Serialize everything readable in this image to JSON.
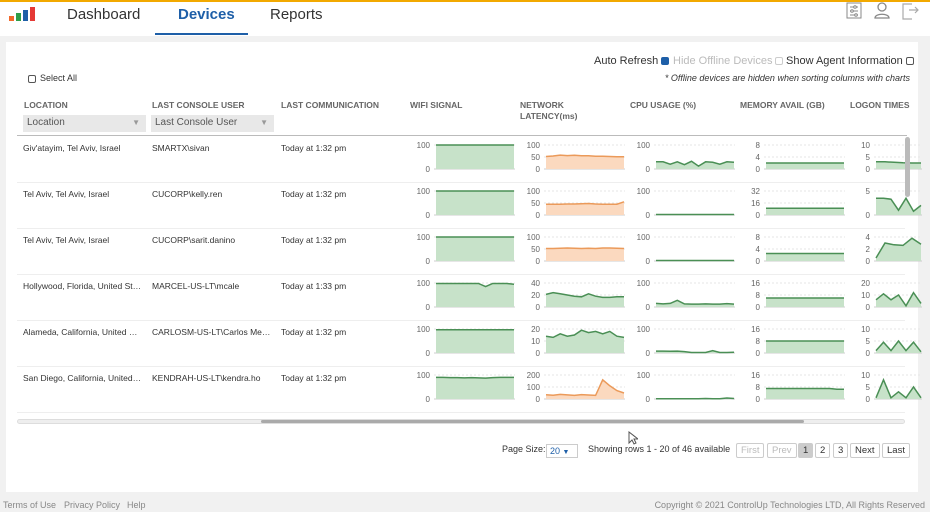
{
  "nav": {
    "tabs": [
      {
        "label": "Dashboard"
      },
      {
        "label": "Devices",
        "active": true
      },
      {
        "label": "Reports"
      }
    ],
    "icons": [
      "settings-sliders-icon",
      "user-icon",
      "logout-icon"
    ]
  },
  "colors": {
    "accent": "#1e5fa8",
    "top_bar": "#f2a900",
    "green_line": "#4a8f55",
    "green_fill": "#c7e2c9",
    "orange_line": "#eb9a5a",
    "orange_fill": "#fbd9bf"
  },
  "options": {
    "auto_refresh": "Auto Refresh",
    "auto_refresh_checked": true,
    "hide_offline": "Hide Offline Devices",
    "hide_offline_checked": false,
    "show_agent": "Show Agent Information",
    "show_agent_checked": false,
    "note": "* Offline devices are hidden when sorting columns with charts",
    "select_all": "Select All"
  },
  "columns": {
    "location": "LOCATION",
    "user": "LAST CONSOLE USER",
    "comm": "LAST COMMUNICATION",
    "wifi": "WIFI SIGNAL",
    "latency": "NETWORK LATENCY(ms)",
    "cpu": "CPU USAGE (%)",
    "mem": "MEMORY AVAIL (GB)",
    "logon": "LOGON TIMES (",
    "location_filter": "Location",
    "user_filter": "Last Console User"
  },
  "rows": [
    {
      "location": "Giv'atayim, Tel Aviv, Israel",
      "user": "SMARTX\\sivan",
      "comm": "Today at 1:32 pm",
      "charts": [
        {
          "ticks": [
            100,
            0
          ],
          "max": 100,
          "color": "green",
          "values": [
            100,
            100,
            100,
            100,
            100,
            100,
            100,
            100,
            100,
            100,
            100,
            100
          ]
        },
        {
          "ticks": [
            100,
            50,
            0
          ],
          "max": 100,
          "color": "orange",
          "values": [
            52,
            54,
            58,
            56,
            57,
            55,
            55,
            53,
            53,
            52,
            51,
            51
          ]
        },
        {
          "ticks": [
            100,
            0
          ],
          "max": 100,
          "color": "green",
          "values": [
            30,
            30,
            20,
            30,
            18,
            32,
            12,
            30,
            28,
            20,
            30,
            28
          ]
        },
        {
          "ticks": [
            8,
            4,
            0
          ],
          "max": 8,
          "color": "green",
          "values": [
            2,
            2,
            2,
            2,
            2,
            2,
            2,
            2,
            2,
            2,
            2,
            2
          ]
        },
        {
          "ticks": [
            10,
            5,
            0
          ],
          "max": 10,
          "color": "green",
          "values": [
            3,
            3,
            2.8,
            2.6,
            2.5,
            2.5
          ]
        }
      ]
    },
    {
      "location": "Tel Aviv, Tel Aviv, Israel",
      "user": "CUCORP\\kelly.ren",
      "comm": "Today at 1:32 pm",
      "charts": [
        {
          "ticks": [
            100,
            0
          ],
          "max": 100,
          "color": "green",
          "values": [
            100,
            100,
            100,
            100,
            100,
            100,
            100,
            100,
            100,
            100,
            100,
            100
          ]
        },
        {
          "ticks": [
            100,
            50,
            0
          ],
          "max": 100,
          "color": "orange",
          "values": [
            45,
            45,
            45,
            46,
            46,
            47,
            48,
            46,
            45,
            45,
            45,
            55
          ]
        },
        {
          "ticks": [
            100,
            0
          ],
          "max": 100,
          "color": "green",
          "values": [
            2,
            2,
            2,
            2,
            2,
            2,
            2,
            2,
            2,
            2,
            2,
            2
          ]
        },
        {
          "ticks": [
            32,
            16,
            0
          ],
          "max": 32,
          "color": "green",
          "values": [
            9,
            9,
            9,
            9,
            9,
            9,
            9,
            9,
            9,
            9,
            9,
            9
          ]
        },
        {
          "ticks": [
            5,
            0
          ],
          "max": 5,
          "color": "green",
          "values": [
            3.5,
            3.5,
            3.3,
            1,
            3.5,
            0.8,
            2
          ]
        }
      ]
    },
    {
      "location": "Tel Aviv, Tel Aviv, Israel",
      "user": "CUCORP\\sarit.danino",
      "comm": "Today at 1:32 pm",
      "charts": [
        {
          "ticks": [
            100,
            0
          ],
          "max": 100,
          "color": "green",
          "values": [
            100,
            100,
            100,
            100,
            100,
            100,
            100,
            100,
            100,
            100,
            100,
            100
          ]
        },
        {
          "ticks": [
            100,
            50,
            0
          ],
          "max": 100,
          "color": "orange",
          "values": [
            52,
            52,
            53,
            54,
            53,
            52,
            53,
            52,
            54,
            54,
            53,
            52
          ]
        },
        {
          "ticks": [
            100,
            0
          ],
          "max": 100,
          "color": "green",
          "values": [
            2,
            2,
            2,
            2,
            2,
            2,
            2,
            2,
            2,
            2,
            2,
            2
          ]
        },
        {
          "ticks": [
            8,
            4,
            0
          ],
          "max": 8,
          "color": "green",
          "values": [
            2.5,
            2.5,
            2.5,
            2.5,
            2.5,
            2.5,
            2.5,
            2.5,
            2.5,
            2.5,
            2.5,
            2.5
          ]
        },
        {
          "ticks": [
            4,
            2,
            0
          ],
          "max": 4,
          "color": "green",
          "values": [
            0.5,
            3,
            2.7,
            2.6,
            3.8,
            2.8
          ]
        }
      ]
    },
    {
      "location": "Hollywood, Florida, United States",
      "user": "MARCEL-US-LT\\mcale",
      "comm": "Today at 1:33 pm",
      "charts": [
        {
          "ticks": [
            100,
            0
          ],
          "max": 100,
          "color": "green",
          "values": [
            98,
            98,
            98,
            98,
            98,
            98,
            98,
            85,
            98,
            98,
            98,
            95
          ]
        },
        {
          "ticks": [
            40,
            20,
            0
          ],
          "max": 40,
          "color": "green",
          "values": [
            21,
            24,
            22,
            20,
            18,
            17,
            22,
            18,
            16,
            16,
            17,
            17
          ]
        },
        {
          "ticks": [
            100,
            0
          ],
          "max": 100,
          "color": "green",
          "values": [
            15,
            13,
            15,
            28,
            13,
            12,
            12,
            13,
            12,
            12,
            14,
            12
          ]
        },
        {
          "ticks": [
            16,
            8,
            0
          ],
          "max": 16,
          "color": "green",
          "values": [
            6,
            6,
            6,
            6,
            6,
            6,
            6,
            6,
            6,
            6,
            6,
            6
          ]
        },
        {
          "ticks": [
            20,
            10,
            0
          ],
          "max": 20,
          "color": "green",
          "values": [
            6,
            11,
            6,
            10,
            1,
            12,
            3
          ]
        }
      ]
    },
    {
      "location": "Alameda, California, United States",
      "user": "CARLOSM-US-LT\\Carlos Mendez",
      "comm": "Today at 1:32 pm",
      "charts": [
        {
          "ticks": [
            100,
            0
          ],
          "max": 100,
          "color": "green",
          "values": [
            97,
            97,
            97,
            97,
            97,
            97,
            97,
            97,
            97,
            97,
            97,
            97
          ]
        },
        {
          "ticks": [
            20,
            10,
            0
          ],
          "max": 20,
          "color": "green",
          "values": [
            14,
            13,
            16,
            14,
            15,
            19,
            17,
            18,
            16,
            18,
            14,
            13
          ]
        },
        {
          "ticks": [
            100,
            0
          ],
          "max": 100,
          "color": "green",
          "values": [
            8,
            8,
            7,
            8,
            6,
            2,
            2,
            2,
            10,
            2,
            2,
            3
          ]
        },
        {
          "ticks": [
            16,
            8,
            0
          ],
          "max": 16,
          "color": "green",
          "values": [
            8,
            8,
            8,
            8,
            8,
            8,
            8,
            8,
            8,
            8,
            8,
            8
          ]
        },
        {
          "ticks": [
            10,
            5,
            0
          ],
          "max": 10,
          "color": "green",
          "values": [
            1,
            4.5,
            1,
            5,
            1,
            4.5,
            0.5
          ]
        }
      ]
    },
    {
      "location": "San Diego, California, United States",
      "user": "KENDRAH-US-LT\\kendra.ho",
      "comm": "Today at 1:32 pm",
      "charts": [
        {
          "ticks": [
            100,
            0
          ],
          "max": 100,
          "color": "green",
          "values": [
            90,
            90,
            89,
            89,
            88,
            89,
            88,
            87,
            89,
            90,
            90,
            90
          ]
        },
        {
          "ticks": [
            200,
            100,
            0
          ],
          "max": 200,
          "color": "orange",
          "values": [
            35,
            32,
            38,
            34,
            30,
            37,
            33,
            30,
            160,
            110,
            70,
            50
          ]
        },
        {
          "ticks": [
            100,
            0
          ],
          "max": 100,
          "color": "green",
          "values": [
            1,
            1,
            1,
            1,
            1,
            1,
            1,
            2,
            1,
            1,
            4,
            2
          ]
        },
        {
          "ticks": [
            16,
            8,
            0
          ],
          "max": 16,
          "color": "green",
          "values": [
            7,
            7,
            7,
            7,
            7,
            7,
            7,
            7,
            7,
            7,
            6.5,
            6.5
          ]
        },
        {
          "ticks": [
            10,
            5,
            0
          ],
          "max": 10,
          "color": "green",
          "values": [
            0.5,
            8,
            0.5,
            3,
            0.5,
            5,
            0.5
          ]
        }
      ]
    }
  ],
  "pagination": {
    "page_size_label": "Page Size:",
    "page_size": "20",
    "showing": "Showing rows 1 - 20 of 46 available",
    "first": "First",
    "prev": "Prev",
    "pages": [
      "1",
      "2",
      "3"
    ],
    "current": "1",
    "next": "Next",
    "last": "Last"
  },
  "footer": {
    "links": [
      "Terms of Use",
      "Privacy Policy",
      "Help"
    ],
    "copyright": "Copyright © 2021 ControlUp Technologies LTD, All Rights Reserved"
  }
}
